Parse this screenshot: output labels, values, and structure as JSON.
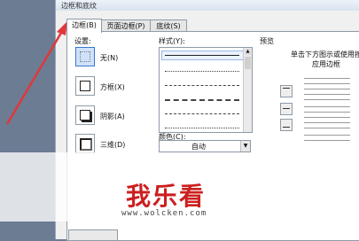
{
  "dialog": {
    "title": "边框和底纹"
  },
  "tabs": [
    {
      "label": "边框(B)"
    },
    {
      "label": "页面边框(P)"
    },
    {
      "label": "底纹(S)"
    }
  ],
  "settings": {
    "heading": "设置:",
    "items": [
      {
        "label": "无(N)"
      },
      {
        "label": "方框(X)"
      },
      {
        "label": "阴影(A)"
      },
      {
        "label": "三维(D)"
      }
    ]
  },
  "style": {
    "heading": "样式(Y):"
  },
  "color": {
    "heading": "颜色(C):",
    "value": "自动"
  },
  "preview": {
    "heading": "预览",
    "hint_line1": "单击下方图示或使用按",
    "hint_line2": "应用边框"
  },
  "watermark": {
    "text": "我乐看",
    "url": "www.wolcken.com"
  },
  "colors": {
    "arrow": "#e0383a",
    "selected_bg": "#cfe2fb",
    "watermark": "#cc1f1f"
  }
}
